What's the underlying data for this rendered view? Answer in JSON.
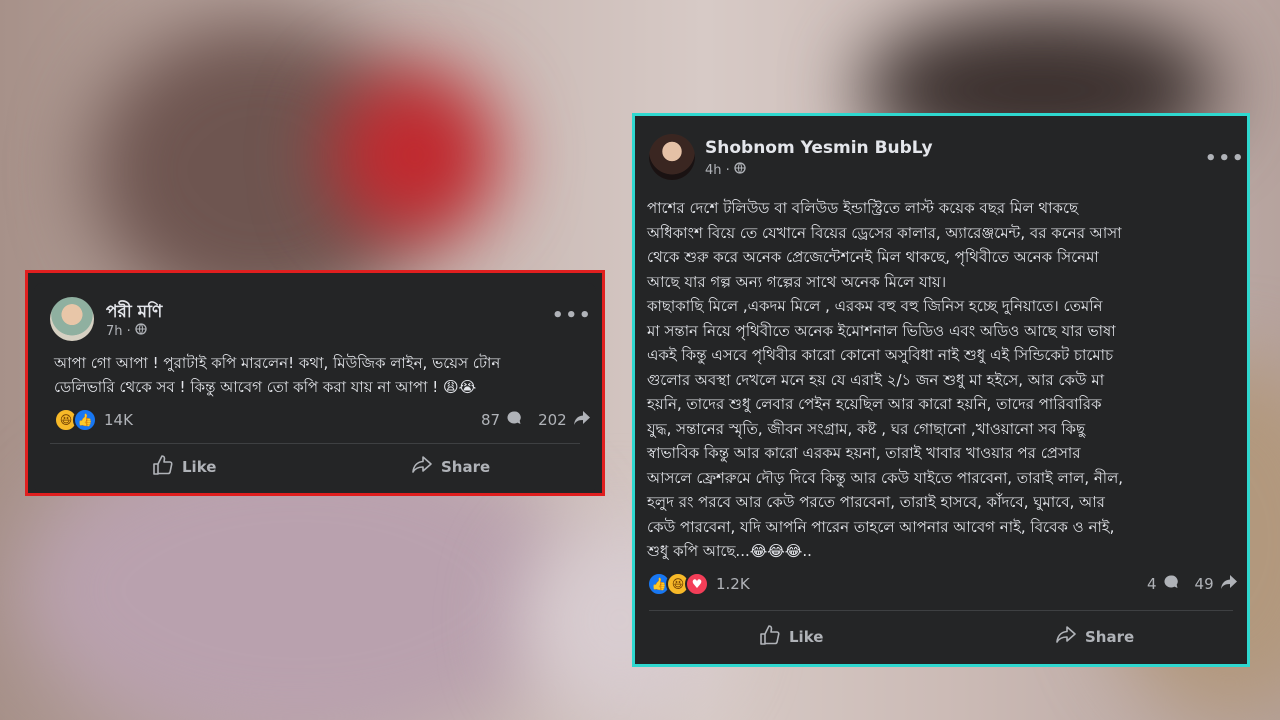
{
  "posts": {
    "left": {
      "author": "পরী মণি",
      "time": "7h ·",
      "text": "আপা গো আপা ! পুরাটাই কপি মারলেন! কথা, মিউজিক লাইন, ভয়েস টোন\nডেলিভারি থেকে সব ! কিন্তু আবেগ তো কপি করা যায় না আপা ! 😩😭",
      "reaction_count": "14K",
      "comments": "87",
      "shares": "202",
      "like_label": "Like",
      "share_label": "Share"
    },
    "right": {
      "author": "Shobnom Yesmin BubLy",
      "time": "4h ·",
      "text": "পাশের দেশে টলিউড বা বলিউড ইন্ডাস্ট্রিতে লাস্ট কয়েক বছর মিল থাকছে\nঅধিকাংশ বিয়ে তে যেখানে বিয়ের ড্রেসের কালার, অ্যারেঞ্জমেন্ট, বর কনের আসা\nথেকে শুরু করে অনেক প্রেজেন্টেশনেই মিল থাকছে, পৃথিবীতে অনেক সিনেমা\nআছে যার গল্প অন্য গল্পের সাথে অনেক মিলে যায়।\nকাছাকাছি মিলে ,একদম মিলে , এরকম বহু বহু জিনিস হচ্ছে দুনিয়াতে। তেমনি\nমা সন্তান নিয়ে পৃথিবীতে অনেক ইমোশনাল ভিডিও এবং অডিও আছে যার ভাষা\nএকই কিন্তু এসবে পৃথিবীর কারো কোনো অসুবিধা নাই শুধু এই সিন্ডিকেট চামোচ\nগুলোর অবস্থা দেখলে মনে হয় যে এরাই ২/১ জন শুধু মা হইসে, আর কেউ মা\nহয়নি, তাদের শুধু লেবার পেইন হয়েছিল আর কারো হয়নি, তাদের পারিবারিক\nযুদ্ধ, সন্তানের স্মৃতি, জীবন সংগ্রাম, কষ্ট , ঘর গোছানো ,খাওয়ানো সব কিছু\nস্বাভাবিক কিন্তু আর কারো এরকম হয়না, তারাই খাবার খাওয়ার পর প্রেসার\nআসলে ফ্রেশরুমে দৌড় দিবে কিন্তু আর কেউ যাইতে পারবেনা, তারাই লাল, নীল,\nহলুদ রং পরবে আর কেউ পরতে পারবেনা, তারাই হাসবে, কাঁদবে, ঘুমাবে, আর\nকেউ পারবেনা, যদি আপনি পারেন তাহলে আপনার আবেগ নাই, বিবেক ও নাই,\nশুধু কপি আছে...😂😂😂..",
      "reaction_count": "1.2K",
      "comments": "4",
      "shares": "49",
      "like_label": "Like",
      "share_label": "Share"
    }
  },
  "colors": {
    "card_bg": "#242526",
    "left_border": "#e01f1f",
    "right_border": "#2fd8cf",
    "text": "#e4e6eb",
    "secondary": "#b0b3b8"
  },
  "icons": [
    "globe-icon",
    "more-options-icon",
    "like-reaction-icon",
    "haha-reaction-icon",
    "love-reaction-icon",
    "comment-icon",
    "share-arrow-icon",
    "thumbs-up-icon",
    "share-icon"
  ]
}
